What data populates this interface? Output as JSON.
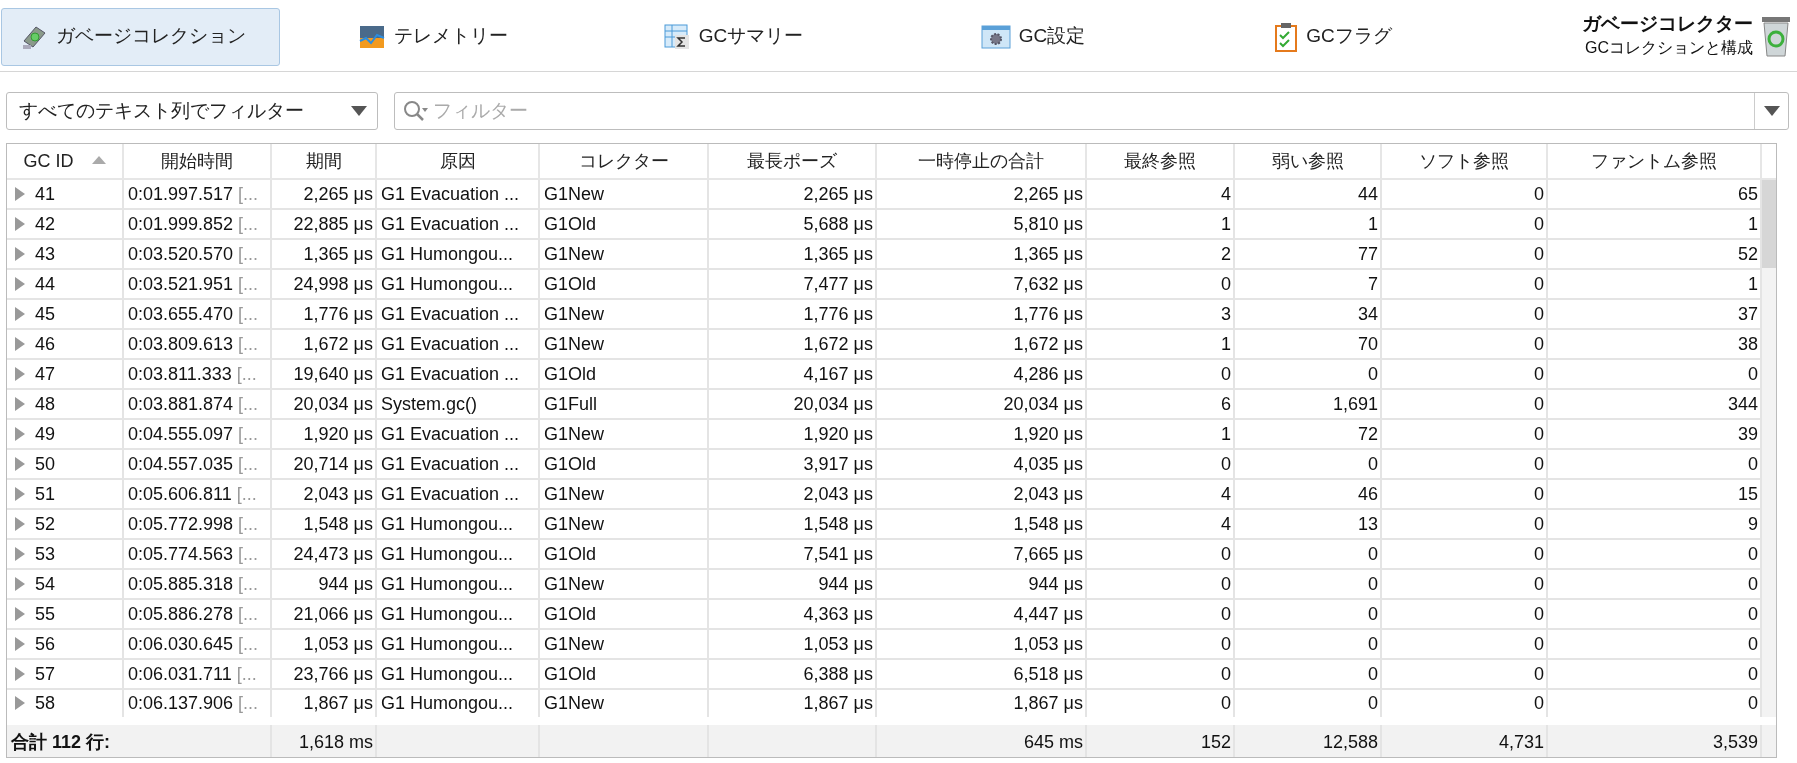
{
  "toolbar": {
    "tabs": [
      {
        "label": "ガベージコレクション",
        "selected": true
      },
      {
        "label": "テレメトリー",
        "selected": false
      },
      {
        "label": "GCサマリー",
        "selected": false
      },
      {
        "label": "GC設定",
        "selected": false
      },
      {
        "label": "GCフラグ",
        "selected": false
      }
    ],
    "title": "ガベージコレクター",
    "subtitle": "GCコレクションと構成"
  },
  "filter": {
    "scope": "すべてのテキスト列でフィルター",
    "placeholder": "フィルター"
  },
  "table": {
    "columns": [
      {
        "label": "GC ID",
        "sorted": true
      },
      {
        "label": "開始時間",
        "sorted": false
      },
      {
        "label": "期間",
        "sorted": false
      },
      {
        "label": "原因",
        "sorted": false
      },
      {
        "label": "コレクター",
        "sorted": false
      },
      {
        "label": "最長ポーズ",
        "sorted": false
      },
      {
        "label": "一時停止の合計",
        "sorted": false
      },
      {
        "label": "最終参照",
        "sorted": false
      },
      {
        "label": "弱い参照",
        "sorted": false
      },
      {
        "label": "ソフト参照",
        "sorted": false
      },
      {
        "label": "ファントム参照",
        "sorted": false
      }
    ],
    "rows": [
      {
        "id": "41",
        "start": "0:01.997.517",
        "start_cut": "[...",
        "duration": "2,265 μs",
        "cause": "G1 Evacuation ...",
        "collector": "G1New",
        "longest": "2,265 μs",
        "total": "2,265 μs",
        "final": "4",
        "weak": "44",
        "soft": "0",
        "phantom": "65"
      },
      {
        "id": "42",
        "start": "0:01.999.852",
        "start_cut": "[...",
        "duration": "22,885 μs",
        "cause": "G1 Evacuation ...",
        "collector": "G1Old",
        "longest": "5,688 μs",
        "total": "5,810 μs",
        "final": "1",
        "weak": "1",
        "soft": "0",
        "phantom": "1"
      },
      {
        "id": "43",
        "start": "0:03.520.570",
        "start_cut": "[...",
        "duration": "1,365 μs",
        "cause": "G1 Humongou...",
        "collector": "G1New",
        "longest": "1,365 μs",
        "total": "1,365 μs",
        "final": "2",
        "weak": "77",
        "soft": "0",
        "phantom": "52"
      },
      {
        "id": "44",
        "start": "0:03.521.951",
        "start_cut": "[...",
        "duration": "24,998 μs",
        "cause": "G1 Humongou...",
        "collector": "G1Old",
        "longest": "7,477 μs",
        "total": "7,632 μs",
        "final": "0",
        "weak": "7",
        "soft": "0",
        "phantom": "1"
      },
      {
        "id": "45",
        "start": "0:03.655.470",
        "start_cut": "[...",
        "duration": "1,776 μs",
        "cause": "G1 Evacuation ...",
        "collector": "G1New",
        "longest": "1,776 μs",
        "total": "1,776 μs",
        "final": "3",
        "weak": "34",
        "soft": "0",
        "phantom": "37"
      },
      {
        "id": "46",
        "start": "0:03.809.613",
        "start_cut": "[...",
        "duration": "1,672 μs",
        "cause": "G1 Evacuation ...",
        "collector": "G1New",
        "longest": "1,672 μs",
        "total": "1,672 μs",
        "final": "1",
        "weak": "70",
        "soft": "0",
        "phantom": "38"
      },
      {
        "id": "47",
        "start": "0:03.811.333",
        "start_cut": "[...",
        "duration": "19,640 μs",
        "cause": "G1 Evacuation ...",
        "collector": "G1Old",
        "longest": "4,167 μs",
        "total": "4,286 μs",
        "final": "0",
        "weak": "0",
        "soft": "0",
        "phantom": "0"
      },
      {
        "id": "48",
        "start": "0:03.881.874",
        "start_cut": "[...",
        "duration": "20,034 μs",
        "cause": "System.gc()",
        "collector": "G1Full",
        "longest": "20,034 μs",
        "total": "20,034 μs",
        "final": "6",
        "weak": "1,691",
        "soft": "0",
        "phantom": "344"
      },
      {
        "id": "49",
        "start": "0:04.555.097",
        "start_cut": "[...",
        "duration": "1,920 μs",
        "cause": "G1 Evacuation ...",
        "collector": "G1New",
        "longest": "1,920 μs",
        "total": "1,920 μs",
        "final": "1",
        "weak": "72",
        "soft": "0",
        "phantom": "39"
      },
      {
        "id": "50",
        "start": "0:04.557.035",
        "start_cut": "[...",
        "duration": "20,714 μs",
        "cause": "G1 Evacuation ...",
        "collector": "G1Old",
        "longest": "3,917 μs",
        "total": "4,035 μs",
        "final": "0",
        "weak": "0",
        "soft": "0",
        "phantom": "0"
      },
      {
        "id": "51",
        "start": "0:05.606.811",
        "start_cut": "[...",
        "duration": "2,043 μs",
        "cause": "G1 Evacuation ...",
        "collector": "G1New",
        "longest": "2,043 μs",
        "total": "2,043 μs",
        "final": "4",
        "weak": "46",
        "soft": "0",
        "phantom": "15"
      },
      {
        "id": "52",
        "start": "0:05.772.998",
        "start_cut": "[...",
        "duration": "1,548 μs",
        "cause": "G1 Humongou...",
        "collector": "G1New",
        "longest": "1,548 μs",
        "total": "1,548 μs",
        "final": "4",
        "weak": "13",
        "soft": "0",
        "phantom": "9"
      },
      {
        "id": "53",
        "start": "0:05.774.563",
        "start_cut": "[...",
        "duration": "24,473 μs",
        "cause": "G1 Humongou...",
        "collector": "G1Old",
        "longest": "7,541 μs",
        "total": "7,665 μs",
        "final": "0",
        "weak": "0",
        "soft": "0",
        "phantom": "0"
      },
      {
        "id": "54",
        "start": "0:05.885.318",
        "start_cut": "[...",
        "duration": "944 μs",
        "cause": "G1 Humongou...",
        "collector": "G1New",
        "longest": "944 μs",
        "total": "944 μs",
        "final": "0",
        "weak": "0",
        "soft": "0",
        "phantom": "0"
      },
      {
        "id": "55",
        "start": "0:05.886.278",
        "start_cut": "[...",
        "duration": "21,066 μs",
        "cause": "G1 Humongou...",
        "collector": "G1Old",
        "longest": "4,363 μs",
        "total": "4,447 μs",
        "final": "0",
        "weak": "0",
        "soft": "0",
        "phantom": "0"
      },
      {
        "id": "56",
        "start": "0:06.030.645",
        "start_cut": "[...",
        "duration": "1,053 μs",
        "cause": "G1 Humongou...",
        "collector": "G1New",
        "longest": "1,053 μs",
        "total": "1,053 μs",
        "final": "0",
        "weak": "0",
        "soft": "0",
        "phantom": "0"
      },
      {
        "id": "57",
        "start": "0:06.031.711",
        "start_cut": "[...",
        "duration": "23,766 μs",
        "cause": "G1 Humongou...",
        "collector": "G1Old",
        "longest": "6,388 μs",
        "total": "6,518 μs",
        "final": "0",
        "weak": "0",
        "soft": "0",
        "phantom": "0"
      },
      {
        "id": "58",
        "start": "0:06.137.906",
        "start_cut": "[...",
        "duration": "1,867 μs",
        "cause": "G1 Humongou...",
        "collector": "G1New",
        "longest": "1,867 μs",
        "total": "1,867 μs",
        "final": "0",
        "weak": "0",
        "soft": "0",
        "phantom": "0"
      }
    ],
    "footer": {
      "label": "合計 112 行:",
      "totals": {
        "duration": "1,618 ms",
        "total": "645 ms",
        "final": "152",
        "weak": "12,588",
        "soft": "4,731",
        "phantom": "3,539"
      }
    }
  }
}
